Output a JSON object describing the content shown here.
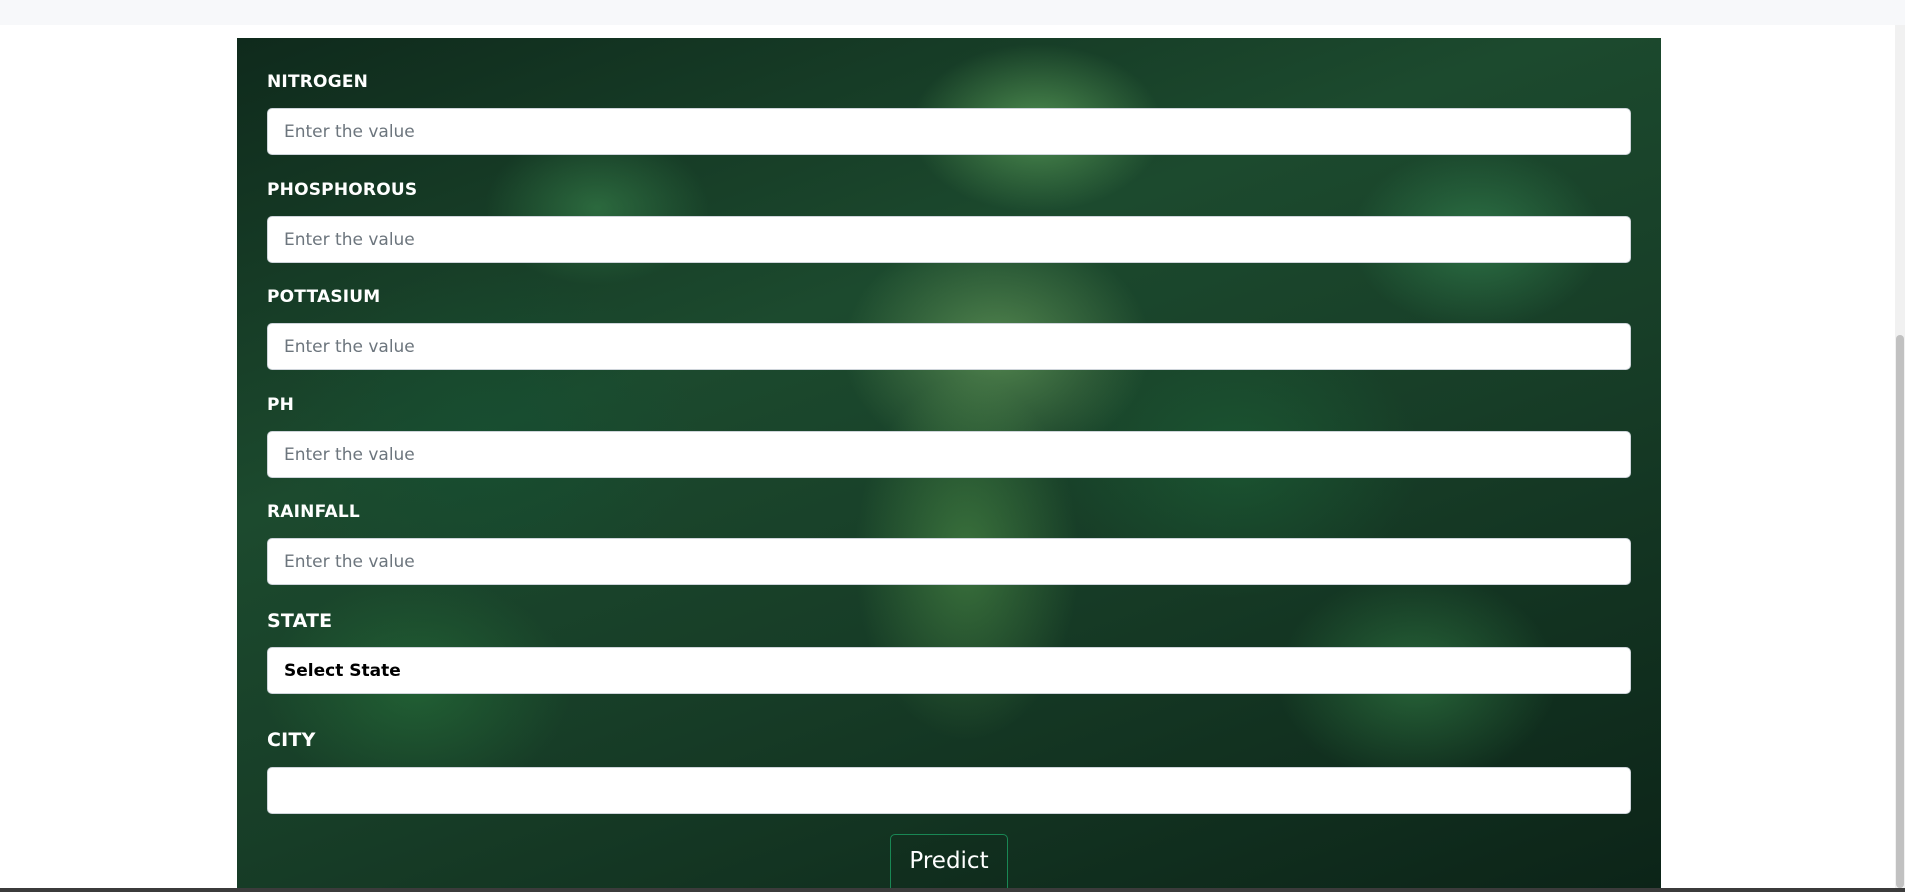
{
  "form": {
    "fields": [
      {
        "label": "NITROGEN",
        "placeholder": "Enter the value",
        "value": ""
      },
      {
        "label": "PHOSPHOROUS",
        "placeholder": "Enter the value",
        "value": ""
      },
      {
        "label": "POTTASIUM",
        "placeholder": "Enter the value",
        "value": ""
      },
      {
        "label": "PH",
        "placeholder": "Enter the value",
        "value": ""
      },
      {
        "label": "RAINFALL",
        "placeholder": "Enter the value",
        "value": ""
      }
    ],
    "state": {
      "label": "STATE",
      "selected": "Select State"
    },
    "city": {
      "label": "CITY",
      "value": ""
    },
    "predict_label": "Predict"
  },
  "colors": {
    "panel_background": "#1c4a2e",
    "button_border": "#198754",
    "label_text": "#ffffff"
  }
}
